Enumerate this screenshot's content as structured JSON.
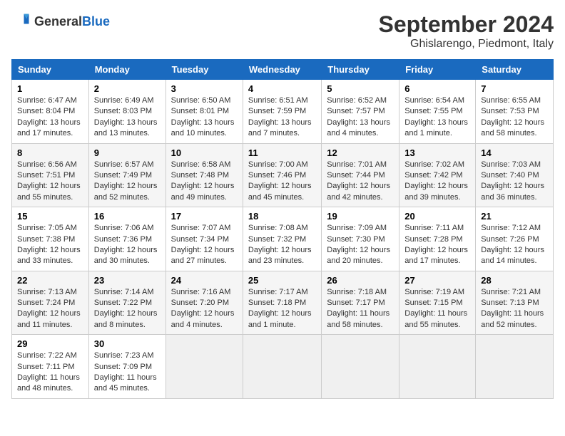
{
  "header": {
    "logo_general": "General",
    "logo_blue": "Blue",
    "title": "September 2024",
    "subtitle": "Ghislarengo, Piedmont, Italy"
  },
  "calendar": {
    "columns": [
      "Sunday",
      "Monday",
      "Tuesday",
      "Wednesday",
      "Thursday",
      "Friday",
      "Saturday"
    ],
    "weeks": [
      [
        null,
        {
          "day": "2",
          "sunrise": "Sunrise: 6:49 AM",
          "sunset": "Sunset: 8:03 PM",
          "daylight": "Daylight: 13 hours and 13 minutes."
        },
        {
          "day": "3",
          "sunrise": "Sunrise: 6:50 AM",
          "sunset": "Sunset: 8:01 PM",
          "daylight": "Daylight: 13 hours and 10 minutes."
        },
        {
          "day": "4",
          "sunrise": "Sunrise: 6:51 AM",
          "sunset": "Sunset: 7:59 PM",
          "daylight": "Daylight: 13 hours and 7 minutes."
        },
        {
          "day": "5",
          "sunrise": "Sunrise: 6:52 AM",
          "sunset": "Sunset: 7:57 PM",
          "daylight": "Daylight: 13 hours and 4 minutes."
        },
        {
          "day": "6",
          "sunrise": "Sunrise: 6:54 AM",
          "sunset": "Sunset: 7:55 PM",
          "daylight": "Daylight: 13 hours and 1 minute."
        },
        {
          "day": "7",
          "sunrise": "Sunrise: 6:55 AM",
          "sunset": "Sunset: 7:53 PM",
          "daylight": "Daylight: 12 hours and 58 minutes."
        }
      ],
      [
        {
          "day": "1",
          "sunrise": "Sunrise: 6:47 AM",
          "sunset": "Sunset: 8:04 PM",
          "daylight": "Daylight: 13 hours and 17 minutes."
        },
        null,
        null,
        null,
        null,
        null,
        null
      ],
      [
        {
          "day": "8",
          "sunrise": "Sunrise: 6:56 AM",
          "sunset": "Sunset: 7:51 PM",
          "daylight": "Daylight: 12 hours and 55 minutes."
        },
        {
          "day": "9",
          "sunrise": "Sunrise: 6:57 AM",
          "sunset": "Sunset: 7:49 PM",
          "daylight": "Daylight: 12 hours and 52 minutes."
        },
        {
          "day": "10",
          "sunrise": "Sunrise: 6:58 AM",
          "sunset": "Sunset: 7:48 PM",
          "daylight": "Daylight: 12 hours and 49 minutes."
        },
        {
          "day": "11",
          "sunrise": "Sunrise: 7:00 AM",
          "sunset": "Sunset: 7:46 PM",
          "daylight": "Daylight: 12 hours and 45 minutes."
        },
        {
          "day": "12",
          "sunrise": "Sunrise: 7:01 AM",
          "sunset": "Sunset: 7:44 PM",
          "daylight": "Daylight: 12 hours and 42 minutes."
        },
        {
          "day": "13",
          "sunrise": "Sunrise: 7:02 AM",
          "sunset": "Sunset: 7:42 PM",
          "daylight": "Daylight: 12 hours and 39 minutes."
        },
        {
          "day": "14",
          "sunrise": "Sunrise: 7:03 AM",
          "sunset": "Sunset: 7:40 PM",
          "daylight": "Daylight: 12 hours and 36 minutes."
        }
      ],
      [
        {
          "day": "15",
          "sunrise": "Sunrise: 7:05 AM",
          "sunset": "Sunset: 7:38 PM",
          "daylight": "Daylight: 12 hours and 33 minutes."
        },
        {
          "day": "16",
          "sunrise": "Sunrise: 7:06 AM",
          "sunset": "Sunset: 7:36 PM",
          "daylight": "Daylight: 12 hours and 30 minutes."
        },
        {
          "day": "17",
          "sunrise": "Sunrise: 7:07 AM",
          "sunset": "Sunset: 7:34 PM",
          "daylight": "Daylight: 12 hours and 27 minutes."
        },
        {
          "day": "18",
          "sunrise": "Sunrise: 7:08 AM",
          "sunset": "Sunset: 7:32 PM",
          "daylight": "Daylight: 12 hours and 23 minutes."
        },
        {
          "day": "19",
          "sunrise": "Sunrise: 7:09 AM",
          "sunset": "Sunset: 7:30 PM",
          "daylight": "Daylight: 12 hours and 20 minutes."
        },
        {
          "day": "20",
          "sunrise": "Sunrise: 7:11 AM",
          "sunset": "Sunset: 7:28 PM",
          "daylight": "Daylight: 12 hours and 17 minutes."
        },
        {
          "day": "21",
          "sunrise": "Sunrise: 7:12 AM",
          "sunset": "Sunset: 7:26 PM",
          "daylight": "Daylight: 12 hours and 14 minutes."
        }
      ],
      [
        {
          "day": "22",
          "sunrise": "Sunrise: 7:13 AM",
          "sunset": "Sunset: 7:24 PM",
          "daylight": "Daylight: 12 hours and 11 minutes."
        },
        {
          "day": "23",
          "sunrise": "Sunrise: 7:14 AM",
          "sunset": "Sunset: 7:22 PM",
          "daylight": "Daylight: 12 hours and 8 minutes."
        },
        {
          "day": "24",
          "sunrise": "Sunrise: 7:16 AM",
          "sunset": "Sunset: 7:20 PM",
          "daylight": "Daylight: 12 hours and 4 minutes."
        },
        {
          "day": "25",
          "sunrise": "Sunrise: 7:17 AM",
          "sunset": "Sunset: 7:18 PM",
          "daylight": "Daylight: 12 hours and 1 minute."
        },
        {
          "day": "26",
          "sunrise": "Sunrise: 7:18 AM",
          "sunset": "Sunset: 7:17 PM",
          "daylight": "Daylight: 11 hours and 58 minutes."
        },
        {
          "day": "27",
          "sunrise": "Sunrise: 7:19 AM",
          "sunset": "Sunset: 7:15 PM",
          "daylight": "Daylight: 11 hours and 55 minutes."
        },
        {
          "day": "28",
          "sunrise": "Sunrise: 7:21 AM",
          "sunset": "Sunset: 7:13 PM",
          "daylight": "Daylight: 11 hours and 52 minutes."
        }
      ],
      [
        {
          "day": "29",
          "sunrise": "Sunrise: 7:22 AM",
          "sunset": "Sunset: 7:11 PM",
          "daylight": "Daylight: 11 hours and 48 minutes."
        },
        {
          "day": "30",
          "sunrise": "Sunrise: 7:23 AM",
          "sunset": "Sunset: 7:09 PM",
          "daylight": "Daylight: 11 hours and 45 minutes."
        },
        null,
        null,
        null,
        null,
        null
      ]
    ]
  }
}
